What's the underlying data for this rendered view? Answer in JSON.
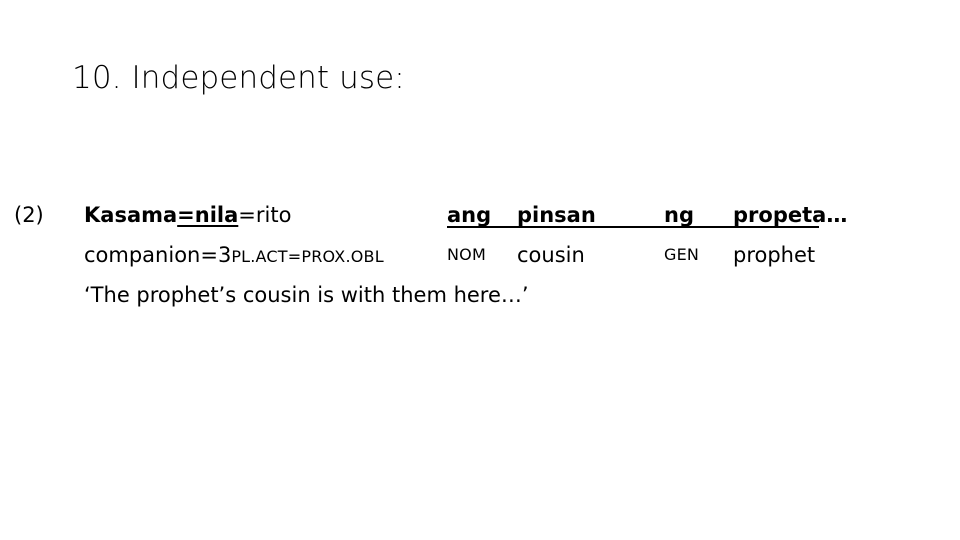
{
  "slide": {
    "title": "10. Independent use:"
  },
  "example": {
    "number": "(2)",
    "object_line": {
      "segments": [
        {
          "text": "Kasama",
          "style": "bold"
        },
        {
          "text": "=nila",
          "style": "bold-underline"
        },
        {
          "text": "=rito",
          "style": "regular"
        }
      ],
      "col_ang": "ang",
      "col_pinsan": "pinsan",
      "col_ng": "ng",
      "col_propeta": "propeta",
      "trailing_ellipsis": "…"
    },
    "gloss_line": {
      "stem": "companion=3",
      "stem_gloss_smallcaps": "PL.ACT=PROX.OBL",
      "col_nom": "NOM",
      "col_cousin": "cousin",
      "col_gen": "GEN",
      "col_prophet": "prophet"
    },
    "translation_line": "‘The prophet’s cousin is with them here…’"
  },
  "colors": {
    "background": "#ffffff",
    "text": "#000000"
  }
}
